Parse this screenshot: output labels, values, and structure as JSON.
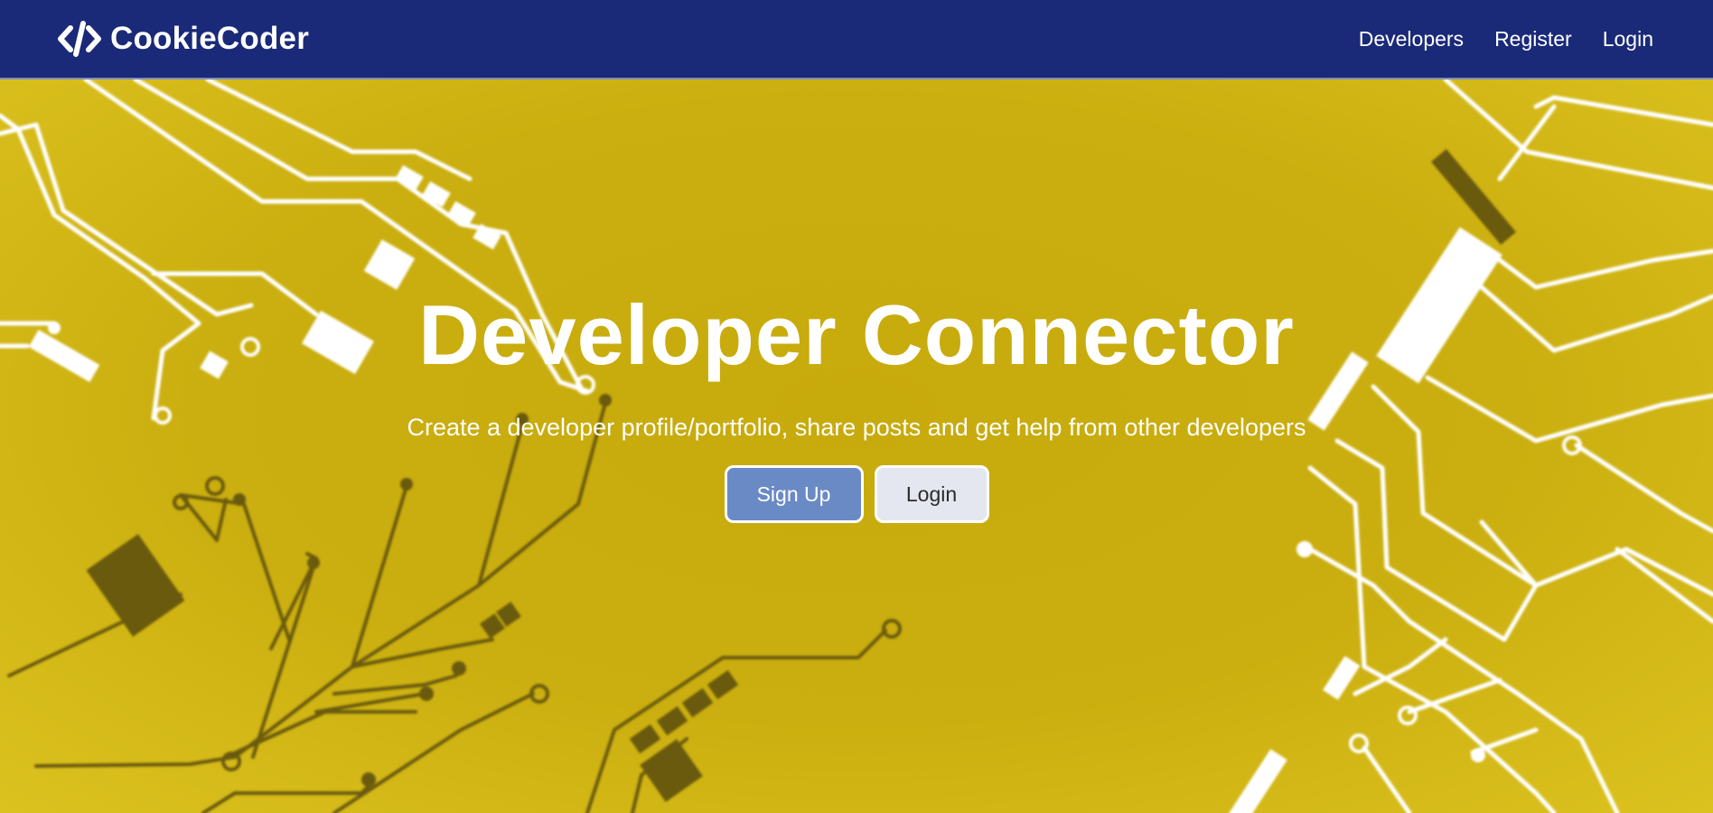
{
  "navbar": {
    "brand_label": "CookieCoder",
    "brand_icon": "code-icon",
    "links": [
      "Developers",
      "Register",
      "Login"
    ]
  },
  "hero": {
    "title": "Developer Connector",
    "lead": "Create a developer profile/portfolio, share posts and get help from other developers",
    "signup_label": "Sign Up",
    "login_label": "Login"
  },
  "theme": {
    "navbar_bg": "#1a2a78",
    "background": "#c9ad0e",
    "signup_bg": "#6a8ac6",
    "login_bg": "#e4e7f0",
    "text_color": "#ffffff",
    "circuit_light": "#ffffff",
    "circuit_dark": "#6b5a0a"
  }
}
